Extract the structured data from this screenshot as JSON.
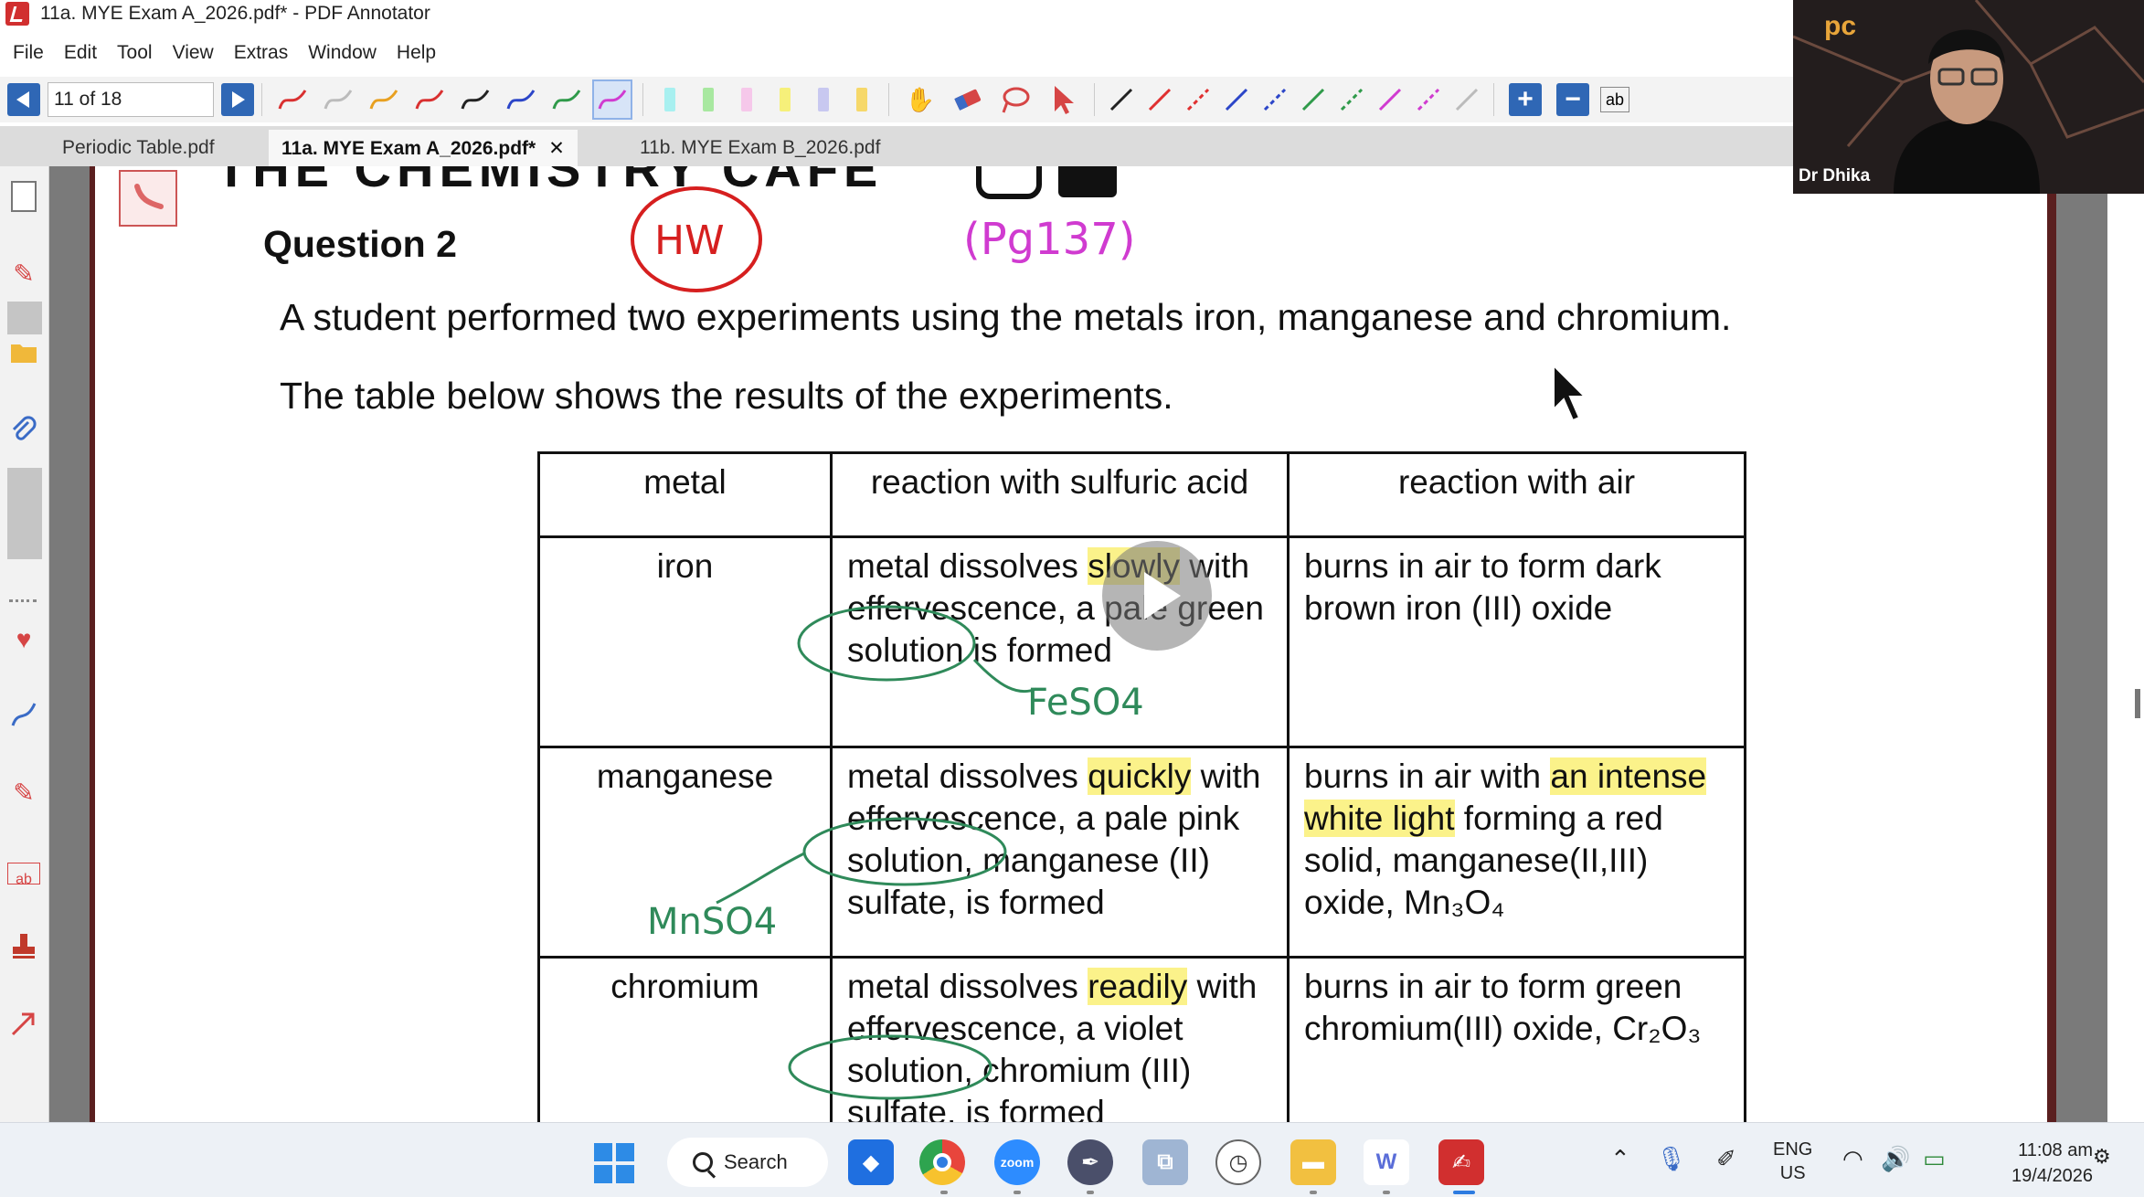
{
  "window": {
    "title": "11a. MYE Exam A_2026.pdf* - PDF Annotator"
  },
  "menu": [
    "File",
    "Edit",
    "Tool",
    "View",
    "Extras",
    "Window",
    "Help"
  ],
  "toolbar": {
    "page_indicator": "11 of 18",
    "pen_colors": [
      "#d93030",
      "#bbbbbb",
      "#e8a020",
      "#d93030",
      "#222222",
      "#2b45c8",
      "#2f9a4a",
      "#d03bd0"
    ],
    "highlighter_colors": [
      "#a8f0f0",
      "#a8e8a0",
      "#f6c8ea",
      "#f6f07a",
      "#c8c8f0",
      "#f6d86a"
    ],
    "line_colors": [
      "#222222",
      "#e03030",
      "#e03030",
      "#2b45c8",
      "#2b45c8",
      "#2f9a4a",
      "#2f9a4a",
      "#d03bd0",
      "#d03bd0",
      "#bbbbbb"
    ],
    "text_tool_label": "ab"
  },
  "tabs": [
    {
      "label": "Periodic Table.pdf",
      "active": false
    },
    {
      "label": "11a. MYE Exam A_2026.pdf*",
      "active": true
    },
    {
      "label": "11b. MYE Exam B_2026.pdf",
      "active": false
    }
  ],
  "tab_close": "✕",
  "document": {
    "cut_header": "THE CHEMISTRY CAFE",
    "question_title": "Question 2",
    "paragraph1": "A student performed two experiments using the metals iron, manganese and chromium.",
    "paragraph2": "The table below shows the results of the experiments.",
    "table": {
      "headers": [
        "metal",
        "reaction with sulfuric acid",
        "reaction with air"
      ],
      "rows": [
        {
          "metal": "iron",
          "acid_parts": [
            "metal dissolves ",
            "slowly",
            " with effervescence, a pale green solution is formed"
          ],
          "air_parts": [
            "burns in air to form dark brown iron (III) oxide",
            "",
            ""
          ]
        },
        {
          "metal": "manganese",
          "acid_parts": [
            "metal dissolves ",
            "quickly",
            " with effervescence, a pale pink solution, manganese (II) sulfate, is formed"
          ],
          "air_parts": [
            "burns in air with ",
            "an intense white light",
            " forming a red solid, manganese(II,III) oxide, Mn₃O₄"
          ]
        },
        {
          "metal": "chromium",
          "acid_parts": [
            "metal dissolves ",
            "readily",
            " with effervescence, a violet solution, chromium (III) sulfate, is formed"
          ],
          "air_parts": [
            "burns in air to form green chromium(III) oxide, Cr₂O₃",
            "",
            ""
          ]
        }
      ]
    },
    "handwriting": {
      "hw_circle": "HW",
      "page_ref": "(Pg137)",
      "feso4": "FeSO4",
      "mnso4": "MnSO4"
    },
    "highlight_color": "#fbf28a"
  },
  "webcam": {
    "logo": "pc",
    "participant_name": "Dr Dhika"
  },
  "taskbar": {
    "search_label": "Search",
    "language": "ENG",
    "region": "US",
    "time": "11:08 am",
    "date": "19/4/2026"
  }
}
